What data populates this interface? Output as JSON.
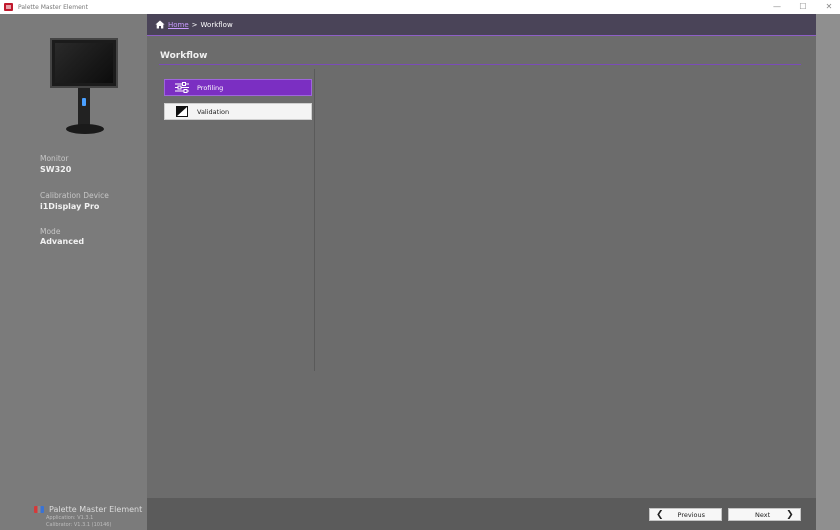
{
  "window": {
    "title": "Palette Master Element",
    "controls": [
      "—",
      "☐",
      "✕"
    ]
  },
  "breadcrumb": {
    "home_label": "Home",
    "separator": ">",
    "current": "Workflow"
  },
  "page": {
    "title": "Workflow"
  },
  "workflow_items": [
    {
      "label": "Profiling",
      "icon": "sliders-icon",
      "active": true
    },
    {
      "label": "Validation",
      "icon": "contrast-icon",
      "active": false
    }
  ],
  "sidebar": {
    "monitor_label": "Monitor",
    "monitor_value": "SW320",
    "device_label": "Calibration Device",
    "device_value": "i1Display Pro",
    "mode_label": "Mode",
    "mode_value": "Advanced",
    "brand_name": "Palette Master Element",
    "app_version": "Application: V1.3.1",
    "calibrator_version": "Calibrator: V1.3.1 (10146)"
  },
  "footer": {
    "previous_label": "Previous",
    "next_label": "Next"
  },
  "colors": {
    "accent": "#7b2fc2",
    "link": "#c89bff",
    "breadcrumb_bg": "#4a4458"
  }
}
